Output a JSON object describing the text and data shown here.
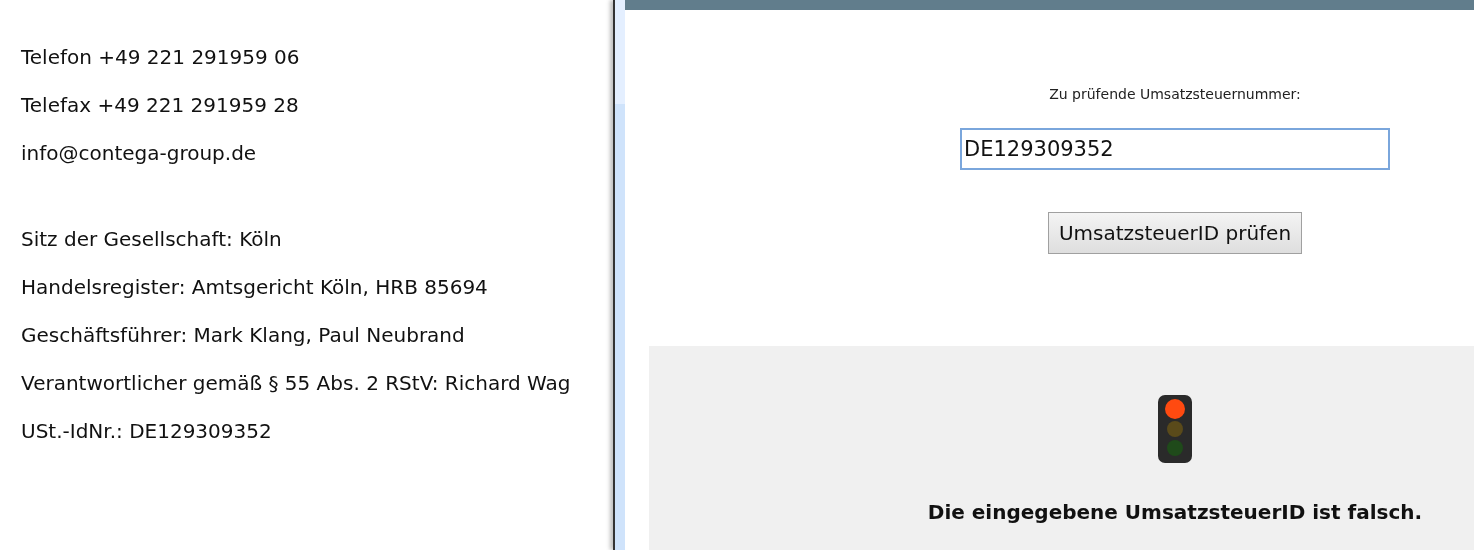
{
  "page": {
    "contact_lines": [
      "Telefon +49 221 291959 06",
      "Telefax +49 221 291959 28",
      "info@contega-group.de"
    ],
    "company_lines": [
      "Sitz der Gesellschaft: Köln",
      "Handelsregister: Amtsgericht Köln, HRB 85694",
      "Geschäftsführer: Mark Klang, Paul Neubrand",
      "Verantwortlicher gemäß § 55 Abs. 2 RStV: Richard Wag",
      "USt.-IdNr.: DE129309352"
    ]
  },
  "vat_check": {
    "label": "Zu prüfende Umsatzsteuernummer:",
    "input_value": "DE129309352",
    "button": "UmsatzsteuerID prüfen",
    "result": {
      "lamps": [
        {
          "on": true
        },
        {
          "on": false
        },
        {
          "on": false
        }
      ],
      "message": "Die eingegebene UmsatzsteuerID ist falsch."
    }
  }
}
